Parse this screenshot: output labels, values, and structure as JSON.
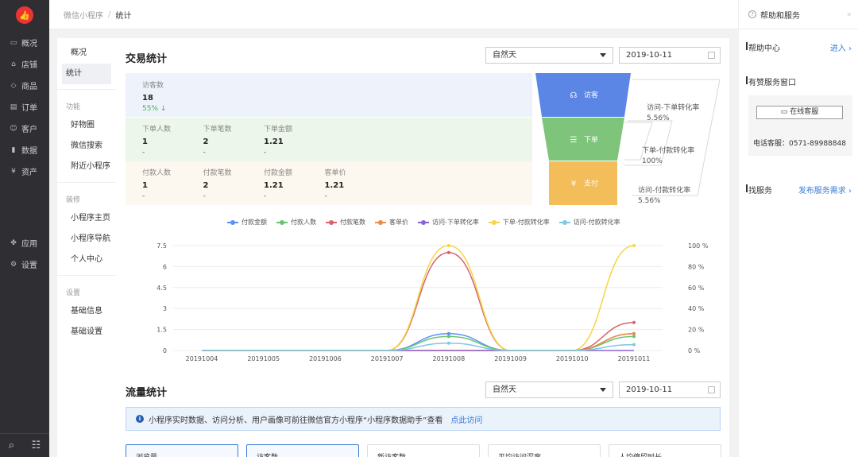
{
  "nav": {
    "logo_glyph": "👍",
    "items": [
      {
        "icon": "monitor-icon",
        "glyph": "▭",
        "label": "概况"
      },
      {
        "icon": "store-icon",
        "glyph": "⌂",
        "label": "店铺"
      },
      {
        "icon": "tag-icon",
        "glyph": "◇",
        "label": "商品"
      },
      {
        "icon": "order-icon",
        "glyph": "▤",
        "label": "订单"
      },
      {
        "icon": "user-icon",
        "glyph": "☺",
        "label": "客户"
      },
      {
        "icon": "chart-icon",
        "glyph": "▮",
        "label": "数据"
      },
      {
        "icon": "money-icon",
        "glyph": "¥",
        "label": "资产"
      }
    ],
    "apps": [
      {
        "icon": "apps-icon",
        "glyph": "✤",
        "label": "应用"
      },
      {
        "icon": "gear-icon",
        "glyph": "⚙",
        "label": "设置"
      }
    ],
    "bottom": {
      "search_glyph": "⌕",
      "chat_glyph": "☷"
    }
  },
  "breadcrumb": {
    "parent": "微信小程序",
    "sep": "/",
    "current": "统计"
  },
  "subnav": {
    "top": [
      {
        "label": "概况"
      },
      {
        "label": "统计",
        "active": true
      }
    ],
    "groups": [
      {
        "title": "功能",
        "items": [
          "好物圈",
          "微信搜索",
          "附近小程序"
        ]
      },
      {
        "title": "装修",
        "items": [
          "小程序主页",
          "小程序导航",
          "个人中心"
        ]
      },
      {
        "title": "设置",
        "items": [
          "基础信息",
          "基础设置"
        ]
      }
    ]
  },
  "trade": {
    "title": "交易统计",
    "period": "自然天",
    "date": "2019-10-11",
    "visitors": {
      "label": "访客数",
      "value": "18",
      "change": "55%",
      "arrow": "↓"
    },
    "orders": [
      {
        "label": "下单人数",
        "value": "1",
        "sub": "-"
      },
      {
        "label": "下单笔数",
        "value": "2",
        "sub": "-"
      },
      {
        "label": "下单金额",
        "value": "1.21",
        "sub": "-"
      }
    ],
    "payments": [
      {
        "label": "付款人数",
        "value": "1",
        "sub": "-"
      },
      {
        "label": "付款笔数",
        "value": "2",
        "sub": "-"
      },
      {
        "label": "付款金额",
        "value": "1.21",
        "sub": "-"
      },
      {
        "label": "客单价",
        "value": "1.21",
        "sub": "-"
      }
    ],
    "funnel": [
      {
        "label": "访客",
        "color": "#5b86e5"
      },
      {
        "label": "下单",
        "color": "#7ec47b"
      },
      {
        "label": "支付",
        "color": "#f3bd5a"
      }
    ],
    "conversions": [
      {
        "label": "访问-下单转化率",
        "value": "5.56%"
      },
      {
        "label": "下单-付款转化率",
        "value": "100%"
      },
      {
        "label": "访问-付款转化率",
        "value": "5.56%"
      }
    ]
  },
  "chart_data": {
    "type": "line",
    "categories": [
      "20191004",
      "20191005",
      "20191006",
      "20191007",
      "20191008",
      "20191009",
      "20191010",
      "20191011"
    ],
    "y_left": {
      "ticks": [
        "0",
        "1.5",
        "3",
        "4.5",
        "6",
        "7.5"
      ],
      "range": [
        0,
        7.5
      ]
    },
    "y_right": {
      "ticks": [
        "0 %",
        "20 %",
        "40 %",
        "60 %",
        "80 %",
        "100 %"
      ],
      "range": [
        0,
        100
      ]
    },
    "series": [
      {
        "name": "付款金额",
        "color": "#5b8ff9",
        "axis": "left",
        "values": [
          0,
          0,
          0,
          0,
          1.21,
          0,
          0,
          1.21
        ]
      },
      {
        "name": "付款人数",
        "color": "#6cc36f",
        "axis": "left",
        "values": [
          0,
          0,
          0,
          0,
          1,
          0,
          0,
          1
        ]
      },
      {
        "name": "付款笔数",
        "color": "#d9636b",
        "axis": "left",
        "values": [
          0,
          0,
          0,
          0,
          7,
          0,
          0,
          2
        ]
      },
      {
        "name": "客单价",
        "color": "#f08a3c",
        "axis": "left",
        "values": [
          0,
          0,
          0,
          0,
          0,
          0,
          0,
          1.21
        ]
      },
      {
        "name": "访问-下单转化率",
        "color": "#8a63d2",
        "axis": "right",
        "values": [
          0,
          0,
          0,
          0,
          0,
          0,
          0,
          0
        ]
      },
      {
        "name": "下单-付款转化率",
        "color": "#f5d547",
        "axis": "right",
        "values": [
          0,
          0,
          0,
          0,
          100,
          0,
          0,
          100
        ]
      },
      {
        "name": "访问-付款转化率",
        "color": "#7ec8e3",
        "axis": "right",
        "values": [
          0,
          0,
          0,
          0,
          7,
          0,
          0,
          5.56
        ]
      }
    ],
    "grid": true,
    "legend": "top"
  },
  "traffic": {
    "title": "流量统计",
    "period": "自然天",
    "date": "2019-10-11",
    "info": "小程序实时数据、访问分析、用户画像可前往微信官方小程序“小程序数据助手”查看",
    "info_link": "点此访问",
    "tabs": [
      "浏览量",
      "访客数",
      "新访客数",
      "平均访问深度",
      "人均停留时长"
    ]
  },
  "right": {
    "title": "帮助和服务",
    "help_center": "帮助中心",
    "enter": "进入",
    "window": "有赞服务窗口",
    "online": "在线客服",
    "phone": "电话客服：0571-89988848",
    "find": "找服务",
    "publish": "发布服务需求"
  }
}
